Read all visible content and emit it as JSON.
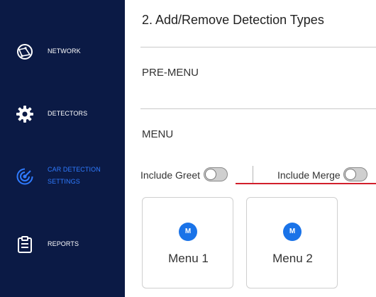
{
  "sidebar": {
    "items": [
      {
        "label": "NETWORK",
        "icon": "network-globe-icon",
        "active": false
      },
      {
        "label": "DETECTORS",
        "icon": "gear-icon",
        "active": false
      },
      {
        "label_line1": "CAR DETECTION",
        "label_line2": "SETTINGS",
        "icon": "radar-target-icon",
        "active": true
      },
      {
        "label": "REPORTS",
        "icon": "clipboard-icon",
        "active": false
      }
    ],
    "colors": {
      "background": "#0b1a45",
      "active": "#2f7bff"
    }
  },
  "main": {
    "title": "2. Add/Remove Detection Types",
    "sections": {
      "premenu": "PRE-MENU",
      "menu": "MENU"
    },
    "toggles": {
      "greet_label": "Include Greet",
      "greet_on": false,
      "merge_label": "Include Merge",
      "merge_on": false
    },
    "cards": [
      {
        "badge": "M",
        "label": "Menu 1"
      },
      {
        "badge": "M",
        "label": "Menu 2"
      }
    ],
    "colors": {
      "accent": "#1a73e8",
      "underline": "#d21f2c"
    }
  }
}
